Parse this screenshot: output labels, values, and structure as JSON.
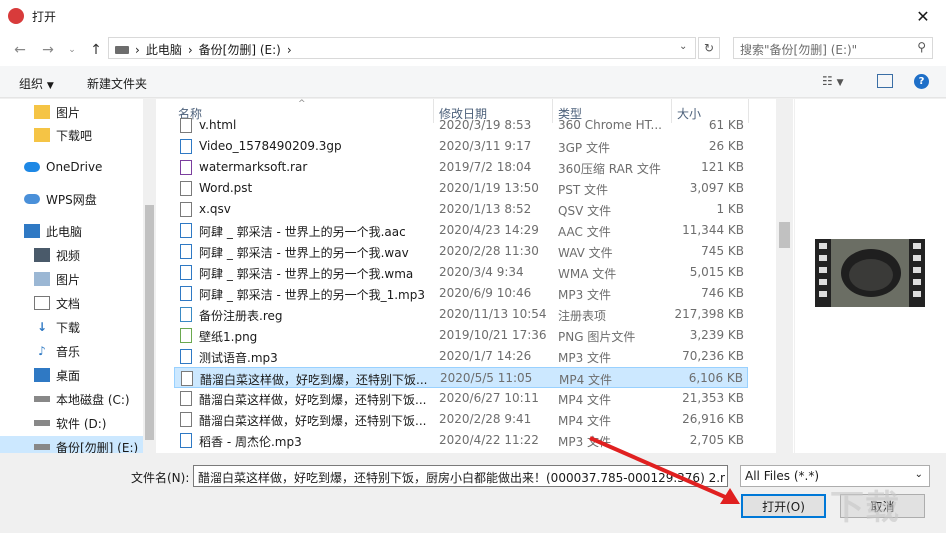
{
  "window": {
    "title": "打开"
  },
  "address": {
    "crumbs": [
      "此电脑",
      "备份[勿删] (E:)"
    ]
  },
  "search": {
    "placeholder": "搜索\"备份[勿删] (E:)\""
  },
  "toolbar": {
    "organize": "组织",
    "new_folder": "新建文件夹"
  },
  "sidebar": {
    "items": [
      "图片",
      "下载吧",
      "OneDrive",
      "WPS网盘",
      "此电脑",
      "视频",
      "图片",
      "文档",
      "下载",
      "音乐",
      "桌面",
      "本地磁盘 (C:)",
      "软件 (D:)",
      "备份[勿删] (E:)"
    ]
  },
  "columns": {
    "name": "名称",
    "date": "修改日期",
    "type": "类型",
    "size": "大小"
  },
  "files": [
    {
      "name": "v.html",
      "date": "2020/3/19 8:53",
      "type": "360 Chrome HT...",
      "size": "61 KB"
    },
    {
      "name": "Video_1578490209.3gp",
      "date": "2020/3/11 9:17",
      "type": "3GP 文件",
      "size": "26 KB"
    },
    {
      "name": "watermarksoft.rar",
      "date": "2019/7/2 18:04",
      "type": "360压缩 RAR 文件",
      "size": "121 KB"
    },
    {
      "name": "Word.pst",
      "date": "2020/1/19 13:50",
      "type": "PST 文件",
      "size": "3,097 KB"
    },
    {
      "name": "x.qsv",
      "date": "2020/1/13 8:52",
      "type": "QSV 文件",
      "size": "1 KB"
    },
    {
      "name": "阿肆 _ 郭采洁 - 世界上的另一个我.aac",
      "date": "2020/4/23 14:29",
      "type": "AAC 文件",
      "size": "11,344 KB"
    },
    {
      "name": "阿肆 _ 郭采洁 - 世界上的另一个我.wav",
      "date": "2020/2/28 11:30",
      "type": "WAV 文件",
      "size": "745 KB"
    },
    {
      "name": "阿肆 _ 郭采洁 - 世界上的另一个我.wma",
      "date": "2020/3/4 9:34",
      "type": "WMA 文件",
      "size": "5,015 KB"
    },
    {
      "name": "阿肆 _ 郭采洁 - 世界上的另一个我_1.mp3",
      "date": "2020/6/9 10:46",
      "type": "MP3 文件",
      "size": "746 KB"
    },
    {
      "name": "备份注册表.reg",
      "date": "2020/11/13 10:54",
      "type": "注册表项",
      "size": "217,398 KB"
    },
    {
      "name": "壁纸1.png",
      "date": "2019/10/21 17:36",
      "type": "PNG 图片文件",
      "size": "3,239 KB"
    },
    {
      "name": "测试语音.mp3",
      "date": "2020/1/7 14:26",
      "type": "MP3 文件",
      "size": "70,236 KB"
    },
    {
      "name": "醋溜白菜这样做，好吃到爆，还特别下饭...",
      "date": "2020/5/5 11:05",
      "type": "MP4 文件",
      "size": "6,106 KB"
    },
    {
      "name": "醋溜白菜这样做，好吃到爆，还特别下饭...",
      "date": "2020/6/27 10:11",
      "type": "MP4 文件",
      "size": "21,353 KB"
    },
    {
      "name": "醋溜白菜这样做，好吃到爆，还特别下饭...",
      "date": "2020/2/28 9:41",
      "type": "MP4 文件",
      "size": "26,916 KB"
    },
    {
      "name": "稻香 - 周杰伦.mp3",
      "date": "2020/4/22 11:22",
      "type": "MP3 文件",
      "size": "2,705 KB"
    }
  ],
  "bottom": {
    "filename_label": "文件名(N):",
    "filename_value": "醋溜白菜这样做，好吃到爆，还特别下饭，厨房小白都能做出来！(000037.785-000129.376) 2.r",
    "filetype": "All Files (*.*)",
    "open": "打开(O)",
    "cancel": "取消"
  },
  "colors": {
    "accent": "#0078d7",
    "selected_row": "#cce8ff",
    "arrow": "#e02020"
  }
}
